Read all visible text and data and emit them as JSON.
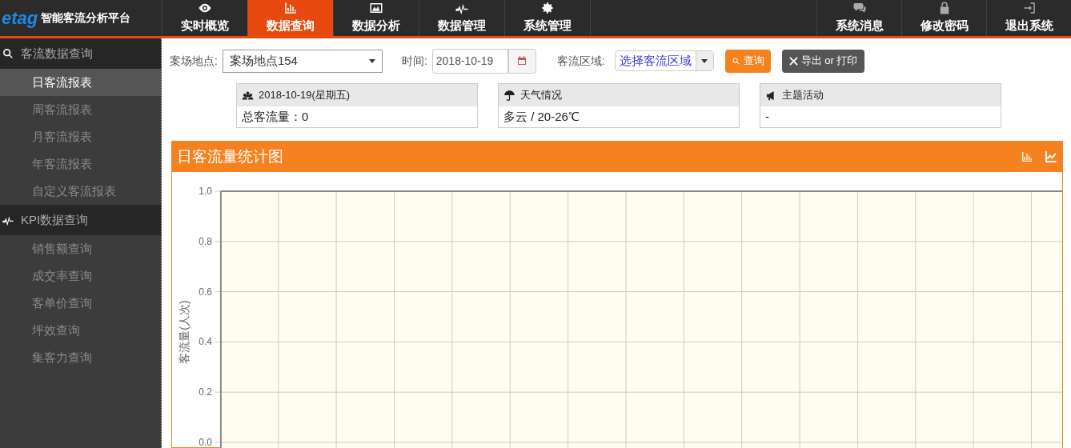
{
  "brand": {
    "logo": "etag",
    "title": "智能客流分析平台"
  },
  "nav": [
    {
      "label": "实时概览",
      "selected": false
    },
    {
      "label": "数据查询",
      "selected": true
    },
    {
      "label": "数据分析",
      "selected": false
    },
    {
      "label": "数据管理",
      "selected": false
    },
    {
      "label": "系统管理",
      "selected": false
    }
  ],
  "nav_right": [
    {
      "label": "系统消息"
    },
    {
      "label": "修改密码"
    },
    {
      "label": "退出系统"
    }
  ],
  "sidebar": [
    {
      "label": "客流数据查询",
      "children": [
        {
          "label": "日客流报表",
          "selected": true
        },
        {
          "label": "周客流报表",
          "selected": false
        },
        {
          "label": "月客流报表",
          "selected": false
        },
        {
          "label": "年客流报表",
          "selected": false
        },
        {
          "label": "自定义客流报表",
          "selected": false
        }
      ]
    },
    {
      "label": "KPI数据查询",
      "children": [
        {
          "label": "销售额查询",
          "selected": false
        },
        {
          "label": "成交率查询",
          "selected": false
        },
        {
          "label": "客单价查询",
          "selected": false
        },
        {
          "label": "坪效查询",
          "selected": false
        },
        {
          "label": "集客力查询",
          "selected": false
        }
      ]
    }
  ],
  "filters": {
    "site_label": "案场地点:",
    "site_value": "案场地点154",
    "date_label": "时间:",
    "date_value": "2018-10-19",
    "area_label": "客流区域:",
    "area_value": "选择客流区域",
    "query_button": "查询",
    "export_button": "导出 or 打印"
  },
  "info_cards": [
    {
      "title": "2018-10-19(星期五)",
      "value": "总客流量：0"
    },
    {
      "title": "天气情况",
      "value": "多云 / 20-26℃"
    },
    {
      "title": "主题活动",
      "value": "-"
    }
  ],
  "chart": {
    "title": "日客流量统计图",
    "ylabel": "客流量(人次)",
    "yticks": [
      "1.0",
      "0.8",
      "0.6",
      "0.4",
      "0.2",
      "0.0"
    ]
  }
}
